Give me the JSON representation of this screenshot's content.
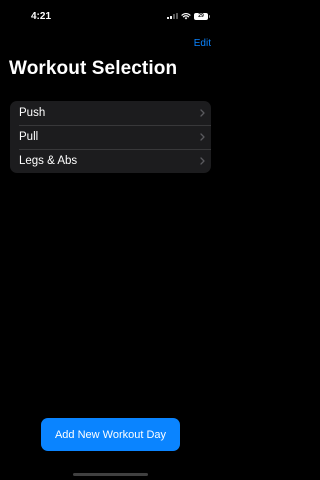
{
  "status_bar": {
    "time": "4:21",
    "battery_level": "29",
    "signal_bars_active": 2,
    "signal_bars_total": 4
  },
  "nav": {
    "edit_label": "Edit"
  },
  "page": {
    "title": "Workout Selection"
  },
  "workouts": {
    "items": [
      {
        "label": "Push",
        "icon": "chevron-right-icon"
      },
      {
        "label": "Pull",
        "icon": "chevron-right-icon"
      },
      {
        "label": "Legs & Abs",
        "icon": "chevron-right-icon"
      }
    ]
  },
  "actions": {
    "add_day_label": "Add New Workout Day"
  },
  "colors": {
    "background": "#000000",
    "list_background": "#1c1c1e",
    "accent": "#0a84ff",
    "text": "#ffffff"
  }
}
